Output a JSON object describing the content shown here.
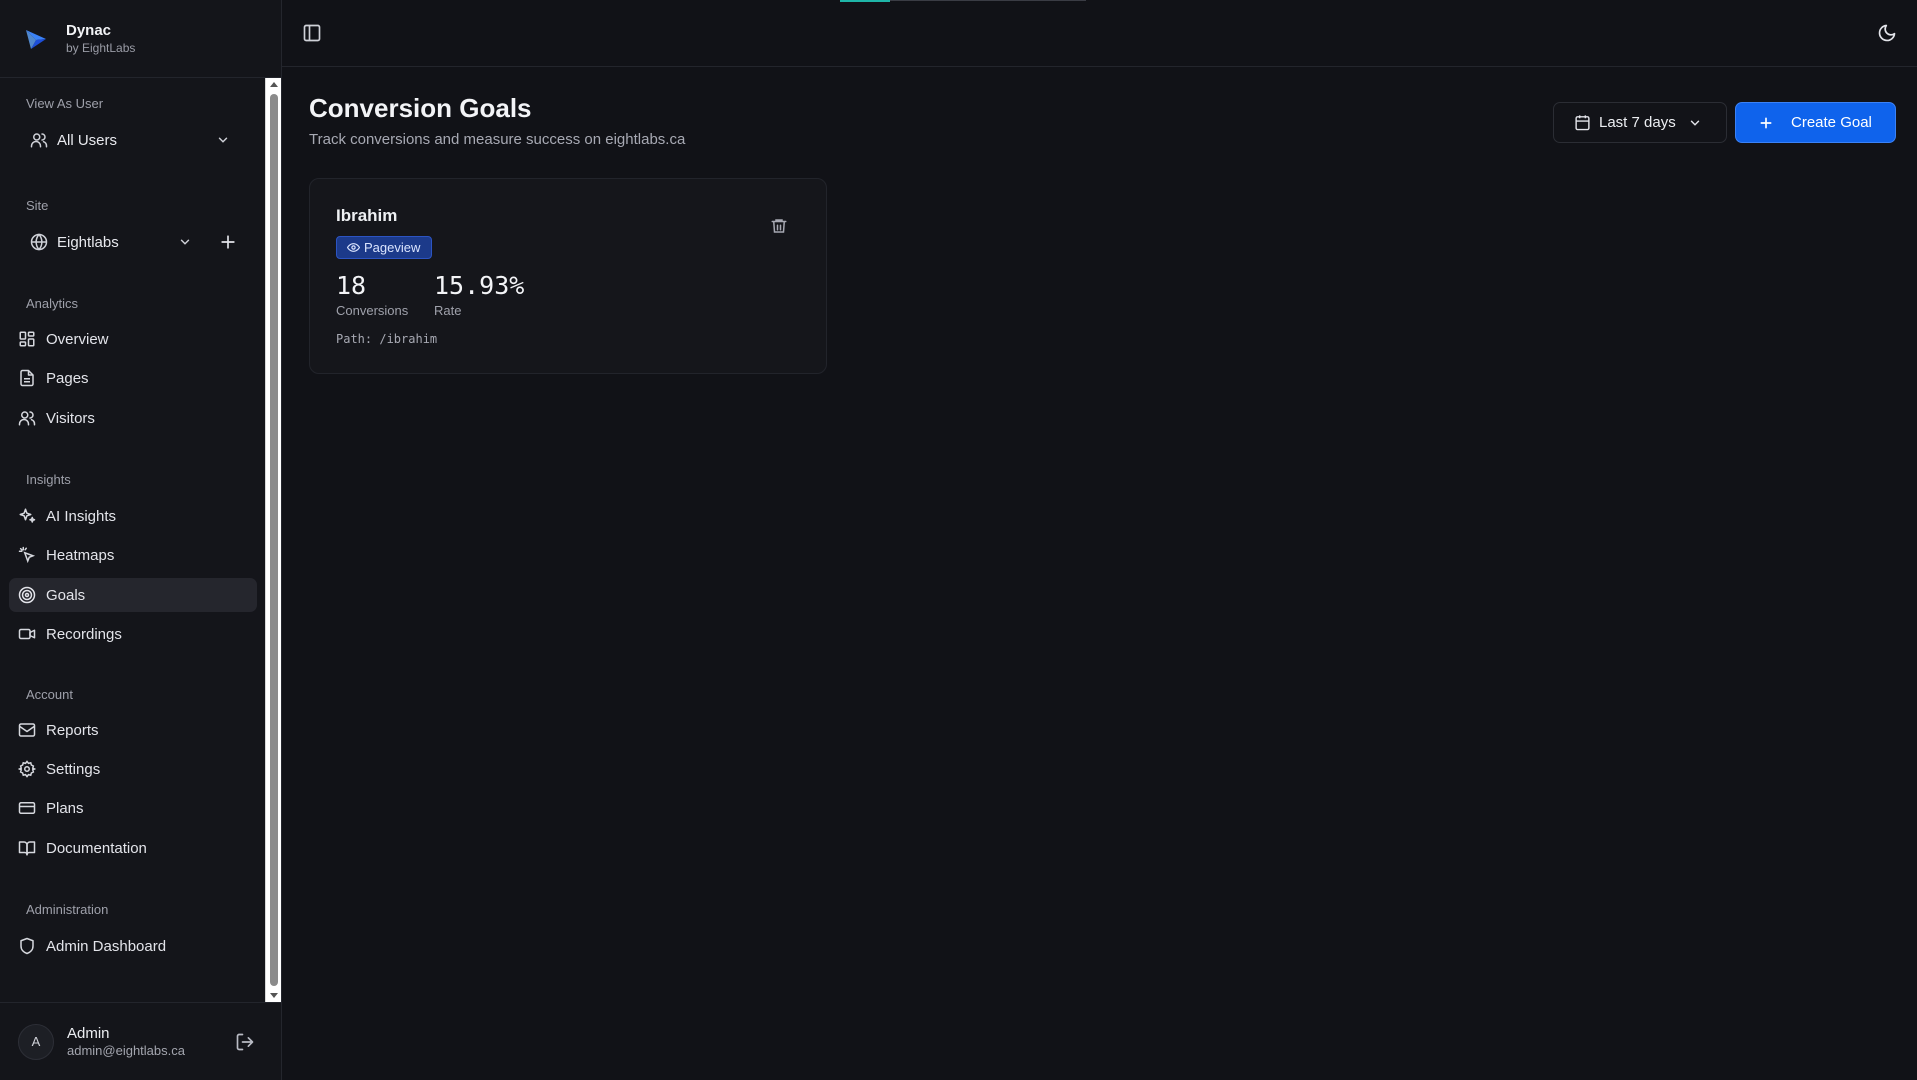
{
  "brand": {
    "name": "Dynac",
    "byline": "by EightLabs",
    "accent": "#3b82f6"
  },
  "sidebar": {
    "view_as_label": "View As User",
    "view_as_value": "All Users",
    "site_label": "Site",
    "site_value": "Eightlabs",
    "sections": [
      {
        "label": "Analytics",
        "items": [
          {
            "label": "Overview",
            "icon": "layout-grid-icon"
          },
          {
            "label": "Pages",
            "icon": "file-text-icon"
          },
          {
            "label": "Visitors",
            "icon": "users-icon"
          }
        ]
      },
      {
        "label": "Insights",
        "items": [
          {
            "label": "AI Insights",
            "icon": "sparkles-icon"
          },
          {
            "label": "Heatmaps",
            "icon": "heatmap-pointer-icon"
          },
          {
            "label": "Goals",
            "icon": "target-icon",
            "active": true
          },
          {
            "label": "Recordings",
            "icon": "video-icon"
          }
        ]
      },
      {
        "label": "Account",
        "items": [
          {
            "label": "Reports",
            "icon": "mail-icon"
          },
          {
            "label": "Settings",
            "icon": "gear-icon"
          },
          {
            "label": "Plans",
            "icon": "credit-card-icon"
          },
          {
            "label": "Documentation",
            "icon": "book-open-icon"
          }
        ]
      },
      {
        "label": "Administration",
        "items": [
          {
            "label": "Admin Dashboard",
            "icon": "shield-icon"
          }
        ]
      }
    ],
    "user": {
      "initial": "A",
      "name": "Admin",
      "email": "admin@eightlabs.ca"
    }
  },
  "page": {
    "title": "Conversion Goals",
    "subtitle": "Track conversions and measure success on eightlabs.ca",
    "date_range": "Last 7 days",
    "create_label": "Create Goal"
  },
  "goals": [
    {
      "name": "Ibrahim",
      "type": "Pageview",
      "conversions": "18",
      "conversions_label": "Conversions",
      "rate": "15.93%",
      "rate_label": "Rate",
      "path": "Path: /ibrahim"
    }
  ],
  "colors": {
    "background": "#111217",
    "sidebar": "#14151a",
    "primary_button": "#0f63ec",
    "badge": "#1c3a8a"
  }
}
